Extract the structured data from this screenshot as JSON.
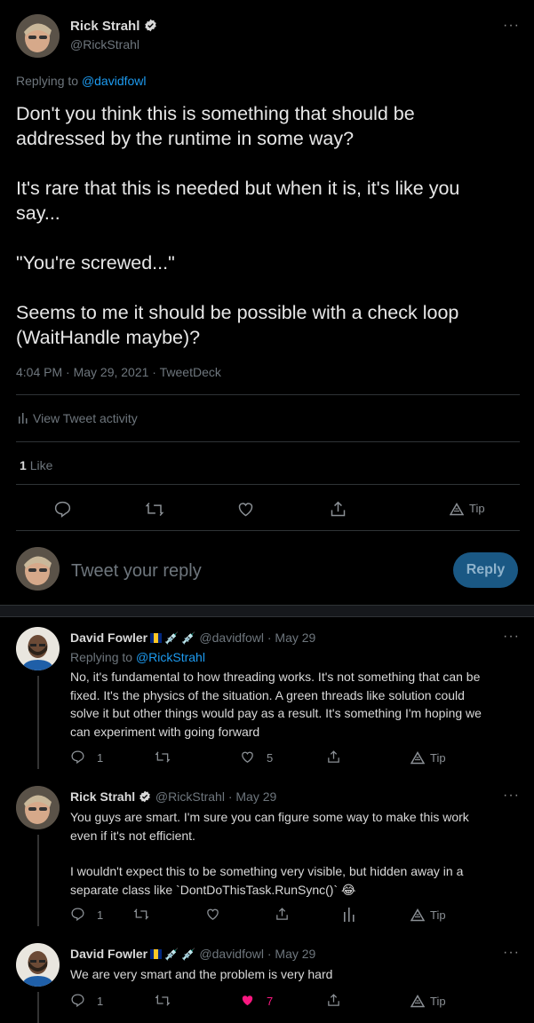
{
  "main_tweet": {
    "author_name": "Rick Strahl",
    "author_handle": "@RickStrahl",
    "replying_prefix": "Replying to",
    "replying_to": "@davidfowl",
    "text_lines": [
      "Don't you think this is something that should be",
      "addressed by the runtime in some way?",
      "",
      "It's rare that this is needed but when it is, it's like you",
      "say...",
      "",
      "\"You're screwed...\"",
      "",
      "Seems to me it should be possible with a check loop",
      "(WaitHandle maybe)?"
    ],
    "timestamp": "4:04 PM · May 29, 2021 · TweetDeck",
    "activity_label": "View Tweet activity",
    "like_count": "1",
    "like_label": "Like",
    "tip_label": "Tip"
  },
  "composer": {
    "placeholder": "Tweet your reply",
    "reply_button": "Reply"
  },
  "replies": [
    {
      "author_name": "David Fowler",
      "handle_date": "@davidfowl · May 29",
      "replying_prefix": "Replying to",
      "replying_to": "@RickStrahl",
      "text_lines": [
        "No, it's fundamental to how threading works. It's not something that can be",
        "fixed. It's the physics of the situation. A green threads like solution could",
        "solve it but other things would pay as a result. It's something I'm hoping we",
        "can experiment with going forward"
      ],
      "reply_count": "1",
      "retweet_count": "",
      "like_count": "5",
      "tip_label": "Tip"
    },
    {
      "author_name": "Rick Strahl",
      "handle_date": "@RickStrahl · May 29",
      "text_lines": [
        "You guys are smart. I'm sure you can figure some way to make this work",
        "even if it's not efficient.",
        "",
        "I wouldn't expect this to be something very visible, but hidden away in a",
        "separate class like `DontDoThisTask.RunSync()` 😂"
      ],
      "reply_count": "1",
      "tip_label": "Tip"
    },
    {
      "author_name": "David Fowler",
      "handle_date": "@davidfowl · May 29",
      "text_lines": [
        "We are very smart and the problem is very hard"
      ],
      "reply_count": "1",
      "like_count": "7",
      "tip_label": "Tip"
    }
  ],
  "colors": {
    "background": "#000000",
    "text": "#d9d9d9",
    "muted": "#6e767d",
    "link": "#1d9bf0",
    "like_active": "#f91880",
    "reply_button_bg": "#1a5884"
  }
}
